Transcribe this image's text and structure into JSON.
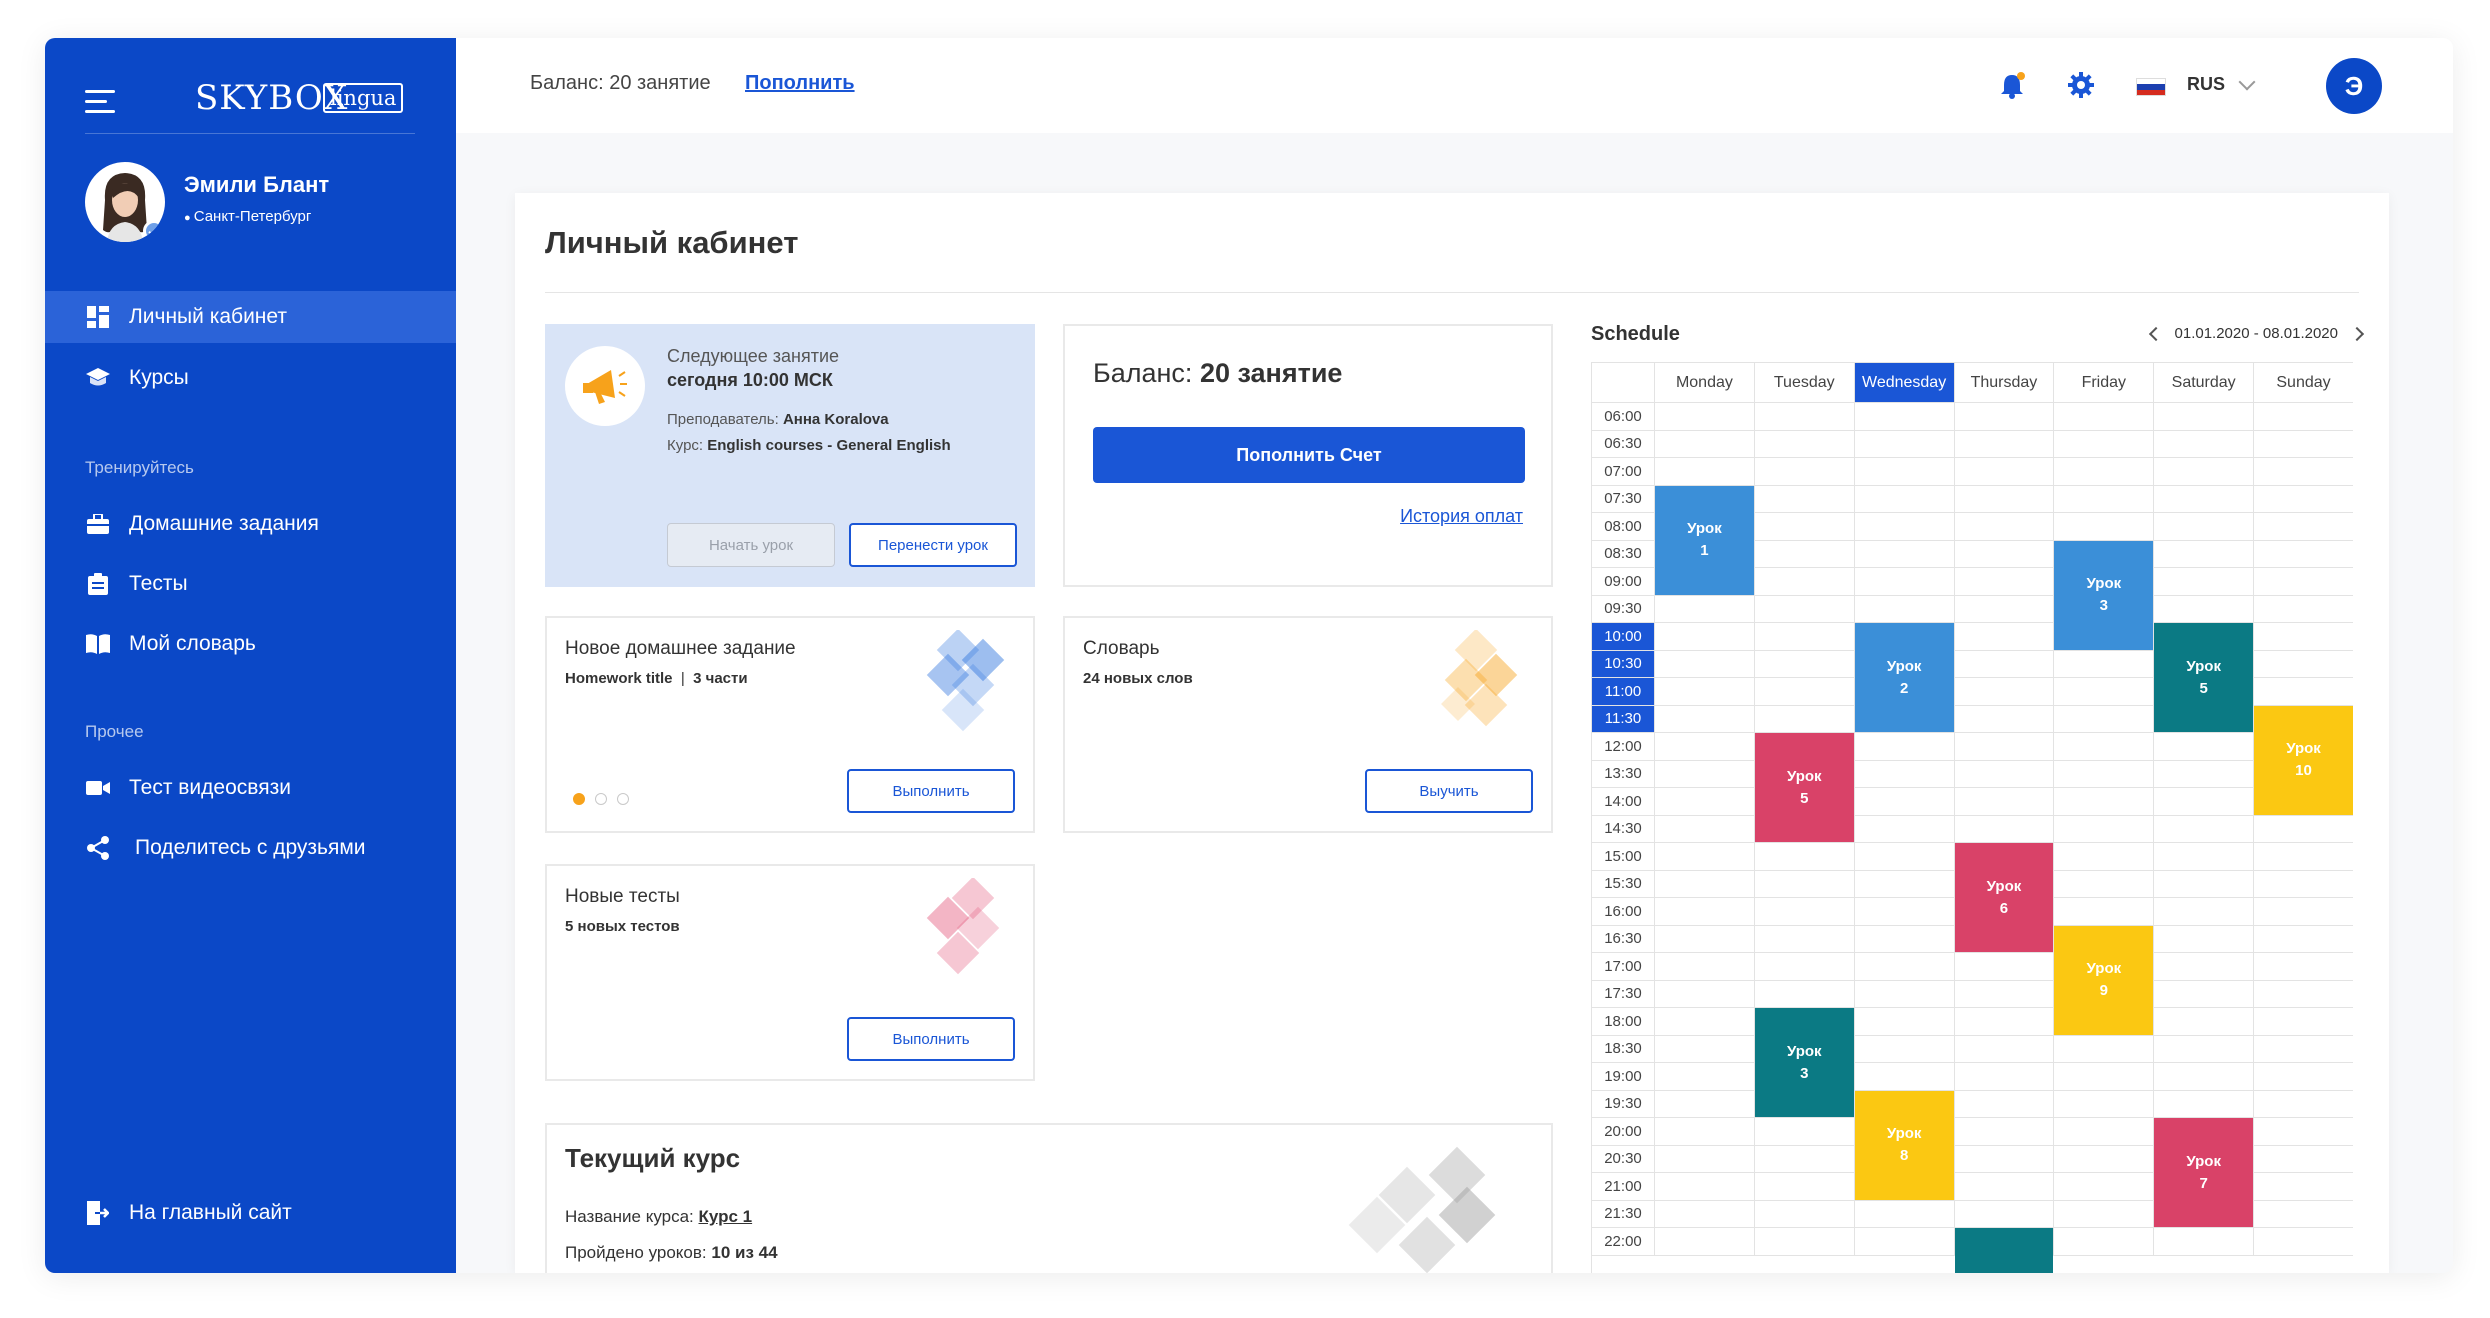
{
  "sidebar": {
    "logo": "SKYBOX",
    "logo_badge": "lingua",
    "profile": {
      "name": "Эмили Блант",
      "city": "Санкт-Петербург"
    },
    "nav": [
      {
        "label": "Личный кабинет",
        "icon": "dashboard-icon",
        "active": true
      },
      {
        "label": "Курсы",
        "icon": "graduation-cap-icon"
      }
    ],
    "section_train": "Тренируйтесь",
    "train_items": [
      {
        "label": "Домашние задания",
        "icon": "briefcase-icon"
      },
      {
        "label": "Тесты",
        "icon": "clipboard-icon"
      },
      {
        "label": "Мой словарь",
        "icon": "book-icon"
      }
    ],
    "section_other": "Прочее",
    "other_items": [
      {
        "label": "Тест видеосвязи",
        "icon": "video-camera-icon"
      },
      {
        "label": "Поделитесь с друзьями",
        "icon": "share-icon"
      }
    ],
    "main_site": {
      "label": "На главный сайт",
      "icon": "exit-icon"
    }
  },
  "header": {
    "balance": "Баланс: 20 занятие",
    "topup": "Пополнить",
    "lang": "RUS",
    "user_initial": "Э"
  },
  "page": {
    "title": "Личный кабинет"
  },
  "next_lesson": {
    "label": "Следующее занятие",
    "time": "сегодня 10:00 МСК",
    "teacher_label": "Преподаватель:",
    "teacher": "Анна Koralova",
    "course_label": "Курс:",
    "course": "English courses - General English",
    "start_btn": "Начать урок",
    "reschedule_btn": "Перенести урок"
  },
  "balance_card": {
    "label": "Баланс:",
    "value": "20 занятие",
    "topup_btn": "Пополнить Счет",
    "history_link": "История оплат"
  },
  "homework": {
    "title": "Новое домашнее задание",
    "sub_title": "Homework title",
    "sub_sep": "|",
    "sub_parts": "3 части",
    "btn": "Выполнить",
    "dots_active": 0
  },
  "dictionary": {
    "title": "Словарь",
    "sub": "24 новых слов",
    "btn": "Выучить"
  },
  "tests": {
    "title": "Новые тесты",
    "sub": "5 новых тестов",
    "btn": "Выполнить"
  },
  "course": {
    "title": "Текущий курс",
    "name_label": "Название курса:",
    "name_value": "Курс 1",
    "progress_label": "Пройдено уроков:",
    "progress_value": "10 из 44"
  },
  "schedule": {
    "title": "Schedule",
    "range": "01.01.2020 - 08.01.2020",
    "days": [
      "Monday",
      "Tuesday",
      "Wednesday",
      "Thursday",
      "Friday",
      "Saturday",
      "Sunday"
    ],
    "today_index": 2,
    "times": [
      "06:00",
      "06:30",
      "07:00",
      "07:30",
      "08:00",
      "08:30",
      "09:00",
      "09:30",
      "10:00",
      "10:30",
      "11:00",
      "11:30",
      "12:00",
      "13:30",
      "14:00",
      "14:30",
      "15:00",
      "15:30",
      "16:00",
      "16:30",
      "17:00",
      "17:30",
      "18:00",
      "18:30",
      "19:00",
      "19:30",
      "20:00",
      "20:30",
      "21:00",
      "21:30",
      "22:00"
    ],
    "highlight_times": [
      "10:00",
      "10:30",
      "11:00",
      "11:30"
    ],
    "colors": {
      "blue": "#3b8fd8",
      "teal": "#0b7a84",
      "red": "#d94268",
      "yellow": "#fbc812"
    },
    "lessons": [
      {
        "label": "Урок",
        "num": "1",
        "day": 0,
        "start": 3,
        "rows": 4,
        "color": "blue"
      },
      {
        "label": "Урок",
        "num": "3",
        "day": 4,
        "start": 5,
        "rows": 4,
        "color": "blue"
      },
      {
        "label": "Урок",
        "num": "2",
        "day": 2,
        "start": 8,
        "rows": 4,
        "color": "blue"
      },
      {
        "label": "Урок",
        "num": "5",
        "day": 5,
        "start": 8,
        "rows": 4,
        "color": "teal"
      },
      {
        "label": "Урок",
        "num": "10",
        "day": 6,
        "start": 11,
        "rows": 4,
        "color": "yellow"
      },
      {
        "label": "Урок",
        "num": "5",
        "day": 1,
        "start": 12,
        "rows": 4,
        "color": "red"
      },
      {
        "label": "Урок",
        "num": "6",
        "day": 3,
        "start": 16,
        "rows": 4,
        "color": "red"
      },
      {
        "label": "Урок",
        "num": "9",
        "day": 4,
        "start": 19,
        "rows": 4,
        "color": "yellow"
      },
      {
        "label": "Урок",
        "num": "3",
        "day": 1,
        "start": 22,
        "rows": 4,
        "color": "teal"
      },
      {
        "label": "Урок",
        "num": "8",
        "day": 2,
        "start": 25,
        "rows": 4,
        "color": "yellow"
      },
      {
        "label": "Урок",
        "num": "7",
        "day": 5,
        "start": 26,
        "rows": 4,
        "color": "red"
      },
      {
        "label": "",
        "num": "",
        "day": 3,
        "start": 30,
        "rows": 2,
        "color": "teal"
      }
    ]
  }
}
